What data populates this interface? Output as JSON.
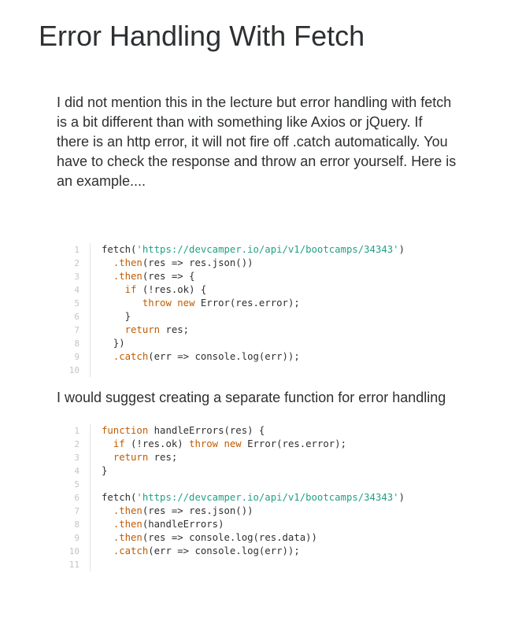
{
  "page": {
    "title": "Error Handling With Fetch",
    "intro": "I did not mention this in the lecture but error handling with fetch is a bit different than with something like Axios or jQuery. If there is an http error, it will not fire off .catch automatically. You have to check the response and throw an error yourself. Here is an example....",
    "suggestion": "I would suggest creating a separate function for error handling"
  },
  "code_blocks": [
    {
      "lines": [
        [
          {
            "t": "fetch("
          },
          {
            "t": "'https://devcamper.io/api/v1/bootcamps/34343'",
            "c": "str"
          },
          {
            "t": ")"
          }
        ],
        [
          {
            "t": "  "
          },
          {
            "t": ".then",
            "c": "mth"
          },
          {
            "t": "(res => res.json())"
          }
        ],
        [
          {
            "t": "  "
          },
          {
            "t": ".then",
            "c": "mth"
          },
          {
            "t": "(res => {"
          }
        ],
        [
          {
            "t": "    "
          },
          {
            "t": "if",
            "c": "kw"
          },
          {
            "t": " (!res.ok) {"
          }
        ],
        [
          {
            "t": "       "
          },
          {
            "t": "throw",
            "c": "kw"
          },
          {
            "t": " "
          },
          {
            "t": "new",
            "c": "kw"
          },
          {
            "t": " Error(res.error);"
          }
        ],
        [
          {
            "t": "    }"
          }
        ],
        [
          {
            "t": "    "
          },
          {
            "t": "return",
            "c": "kw"
          },
          {
            "t": " res;"
          }
        ],
        [
          {
            "t": "  })"
          }
        ],
        [
          {
            "t": "  "
          },
          {
            "t": ".catch",
            "c": "mth"
          },
          {
            "t": "(err => console.log(err));"
          }
        ],
        []
      ]
    },
    {
      "lines": [
        [
          {
            "t": "function",
            "c": "kw"
          },
          {
            "t": " handleErrors(res) {"
          }
        ],
        [
          {
            "t": "  "
          },
          {
            "t": "if",
            "c": "kw"
          },
          {
            "t": " (!res.ok) "
          },
          {
            "t": "throw",
            "c": "kw"
          },
          {
            "t": " "
          },
          {
            "t": "new",
            "c": "kw"
          },
          {
            "t": " Error(res.error);"
          }
        ],
        [
          {
            "t": "  "
          },
          {
            "t": "return",
            "c": "kw"
          },
          {
            "t": " res;"
          }
        ],
        [
          {
            "t": "}"
          }
        ],
        [],
        [
          {
            "t": "fetch("
          },
          {
            "t": "'https://devcamper.io/api/v1/bootcamps/34343'",
            "c": "str"
          },
          {
            "t": ")"
          }
        ],
        [
          {
            "t": "  "
          },
          {
            "t": ".then",
            "c": "mth"
          },
          {
            "t": "(res => res.json())"
          }
        ],
        [
          {
            "t": "  "
          },
          {
            "t": ".then",
            "c": "mth"
          },
          {
            "t": "(handleErrors)"
          }
        ],
        [
          {
            "t": "  "
          },
          {
            "t": ".then",
            "c": "mth"
          },
          {
            "t": "(res => console.log(res.data))"
          }
        ],
        [
          {
            "t": "  "
          },
          {
            "t": ".catch",
            "c": "mth"
          },
          {
            "t": "(err => console.log(err));"
          }
        ],
        []
      ]
    }
  ]
}
